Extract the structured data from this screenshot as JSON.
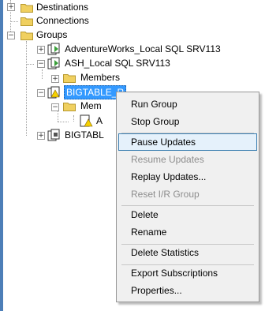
{
  "tree": {
    "destinations": "Destinations",
    "connections": "Connections",
    "groups": "Groups",
    "adventureworks": "AdventureWorks_Local SQL SRV113",
    "ash": "ASH_Local SQL SRV113",
    "members1": "Members",
    "bigtable_selected": "BIGTABLE_R",
    "members2": "Mem",
    "member_item": "A",
    "bigtable2": "BIGTABL"
  },
  "context_menu": {
    "run_group": "Run Group",
    "stop_group": "Stop Group",
    "pause_updates": "Pause Updates",
    "resume_updates": "Resume Updates",
    "replay_updates": "Replay Updates...",
    "reset_ir_group": "Reset I/R Group",
    "delete": "Delete",
    "rename": "Rename",
    "delete_statistics": "Delete Statistics",
    "export_subscriptions": "Export Subscriptions",
    "properties": "Properties..."
  },
  "colors": {
    "selection": "#3399ff",
    "menu_highlight": "#e5f1fb",
    "folder": "#f0d060",
    "group_icon_green": "#3aa03a"
  }
}
